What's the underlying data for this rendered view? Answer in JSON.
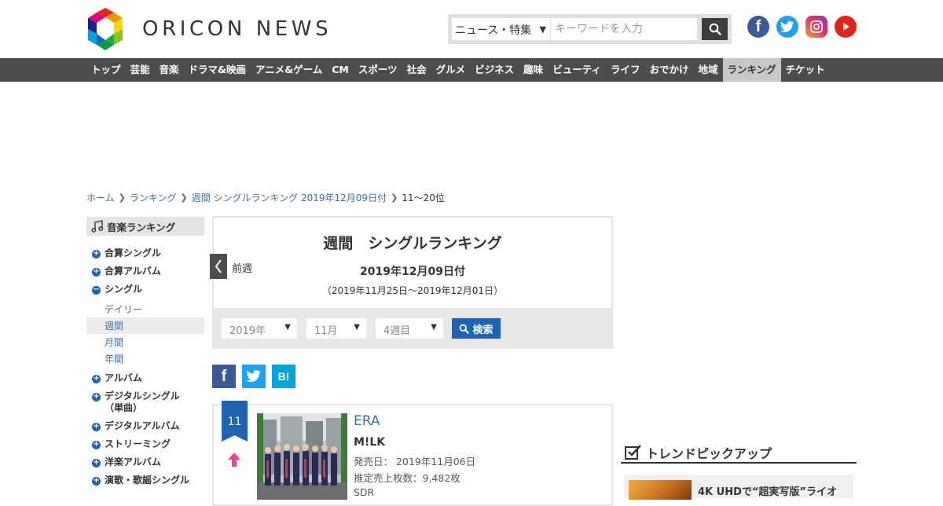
{
  "header": {
    "logo_text": "ORICON NEWS",
    "search_category": "ニュース・特集",
    "search_placeholder": "キーワードを入力"
  },
  "social": {
    "fb": "f"
  },
  "nav": {
    "items": [
      "トップ",
      "芸能",
      "音楽",
      "ドラマ&映画",
      "アニメ&ゲーム",
      "CM",
      "スポーツ",
      "社会",
      "グルメ",
      "ビジネス",
      "趣味",
      "ビューティ",
      "ライフ",
      "おでかけ",
      "地域",
      "ランキング",
      "チケット"
    ],
    "active": "ランキング"
  },
  "breadcrumb": {
    "items": [
      "ホーム",
      "ランキング",
      "週間 シングルランキング 2019年12月09日付"
    ],
    "current": "11～20位"
  },
  "sidebar": {
    "title": "音楽ランキング",
    "items": [
      {
        "label": "合算シングル",
        "mark": "+"
      },
      {
        "label": "合算アルバム",
        "mark": "+"
      },
      {
        "label": "シングル",
        "mark": "-"
      },
      {
        "label": "アルバム",
        "mark": "+"
      },
      {
        "label": "デジタルシングル\n（単曲）",
        "mark": "+"
      },
      {
        "label": "デジタルアルバム",
        "mark": "+"
      },
      {
        "label": "ストリーミング",
        "mark": "+"
      },
      {
        "label": "洋楽アルバム",
        "mark": "+"
      },
      {
        "label": "演歌・歌謡シングル",
        "mark": "+"
      }
    ],
    "subitems": [
      "デイリー",
      "週間",
      "月間",
      "年間"
    ],
    "active_sub": "週間"
  },
  "panel": {
    "title": "週間　シングルランキング",
    "date": "2019年12月09日付",
    "range": "（2019年11月25日～2019年12月01日）",
    "prev_label": "前週",
    "year": "2019年",
    "month": "11月",
    "week": "4週目",
    "search_label": "検索"
  },
  "share": {
    "fb": "f",
    "hatena": "B!"
  },
  "entry": {
    "rank": "11",
    "title": "ERA",
    "artist": "M!LK",
    "release": "発売日：  2019年11月06日",
    "sales": "推定売上枚数：9,482枚",
    "label": "SDR",
    "trend": "up",
    "colors": {
      "badge": "#1f63b5",
      "trend": "#e8468e"
    }
  },
  "trend": {
    "heading": "トレンドピックアップ",
    "first_title": "4K UHDで“超実写版”ライオ"
  }
}
